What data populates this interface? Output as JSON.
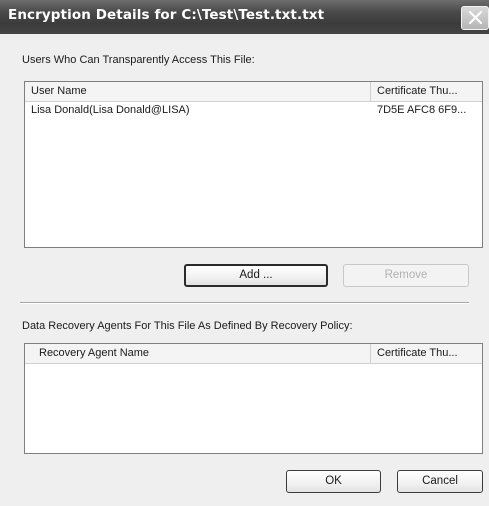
{
  "window": {
    "title": "Encryption Details for C:\\Test\\Test.txt.txt"
  },
  "users_section": {
    "label": "Users Who Can Transparently Access This File:",
    "columns": [
      "User Name",
      "Certificate Thu..."
    ],
    "rows": [
      {
        "user_name": "Lisa Donald(Lisa Donald@LISA)",
        "certificate": "7D5E AFC8 6F9..."
      }
    ],
    "add_label": "Add ...",
    "remove_label": "Remove"
  },
  "recovery_section": {
    "label": "Data Recovery Agents For This File As Defined By Recovery Policy:",
    "columns": [
      "Recovery Agent Name",
      "Certificate Thu..."
    ]
  },
  "footer": {
    "ok_label": "OK",
    "cancel_label": "Cancel"
  },
  "icons": {
    "close": "close-icon"
  }
}
